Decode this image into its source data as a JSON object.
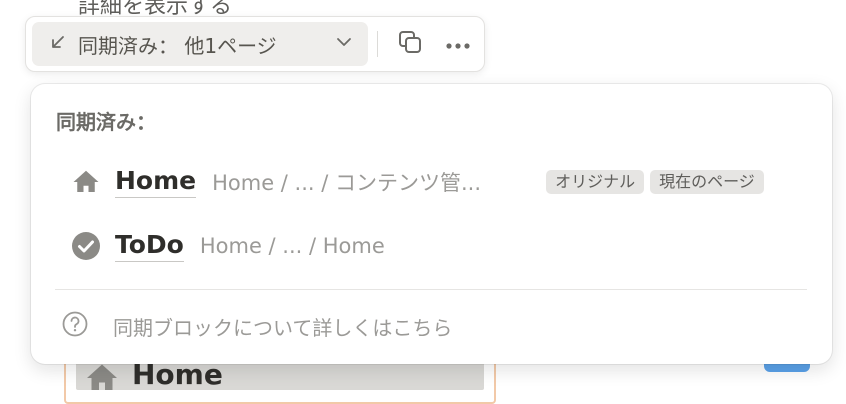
{
  "background": {
    "heading_text": "詳細を表示する",
    "block_title": "Home"
  },
  "toolbar": {
    "sync_button_label": "同期済み：  他1ページ",
    "icons": {
      "sync_arrow": "arrow-down-left-icon",
      "chevron": "chevron-down-icon",
      "copy": "copy-icon",
      "more": "more-horizontal-icon"
    }
  },
  "popover": {
    "title": "同期済み：",
    "pages": [
      {
        "icon": "home-icon",
        "name": "Home",
        "path": "Home / ... / コンテンツ管...",
        "badges": [
          "オリジナル",
          "現在のページ"
        ]
      },
      {
        "icon": "check-circle-icon",
        "name": "ToDo",
        "path": "Home / ... / Home",
        "badges": []
      }
    ],
    "help_text": "同期ブロックについて詳しくはこちら",
    "help_icon": "question-circle-icon"
  },
  "colors": {
    "accent_blue": "#2383e2",
    "muted_text": "#9b9a97",
    "badge_bg": "#e6e5e3",
    "icon_gray": "#8b8a86"
  }
}
